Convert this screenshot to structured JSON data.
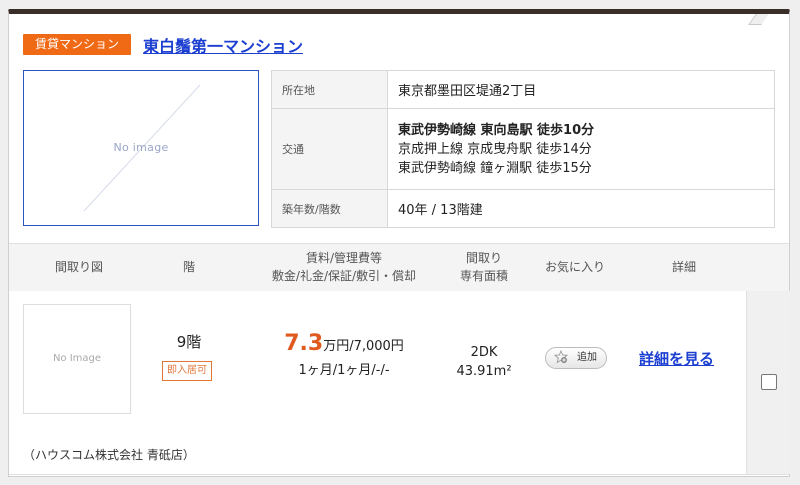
{
  "property": {
    "type_badge": "賃貸マンション",
    "name": "東白鬚第一マンション",
    "photo_label": "No image",
    "info": {
      "address_label": "所在地",
      "address": "東京都墨田区堤通2丁目",
      "access_label": "交通",
      "access": [
        "東武伊勢崎線 東向島駅 徒歩10分",
        "京成押上線 京成曳舟駅 徒歩14分",
        "東武伊勢崎線 鐘ヶ淵駅 徒歩15分"
      ],
      "age_label": "築年数/階数",
      "age": "40年 / 13階建"
    }
  },
  "columns": {
    "floorplan": "間取り図",
    "floor": "階",
    "rent_line1": "賃料/管理費等",
    "rent_line2": "敷金/礼金/保証/敷引・償却",
    "layout_line1": "間取り",
    "layout_line2": "専有面積",
    "favorite": "お気に入り",
    "detail": "詳細"
  },
  "unit": {
    "thumb_label": "No Image",
    "floor": "9階",
    "move_in": "即入居可",
    "rent_value": "7.3",
    "rent_rest": "万円/7,000円",
    "deposit": "1ヶ月/1ヶ月/-/-",
    "layout": "2DK",
    "area": "43.91m²",
    "favorite_button": "追加",
    "detail_link": "詳細を見る",
    "company": "（ハウスコム株式会社 青砥店）"
  }
}
